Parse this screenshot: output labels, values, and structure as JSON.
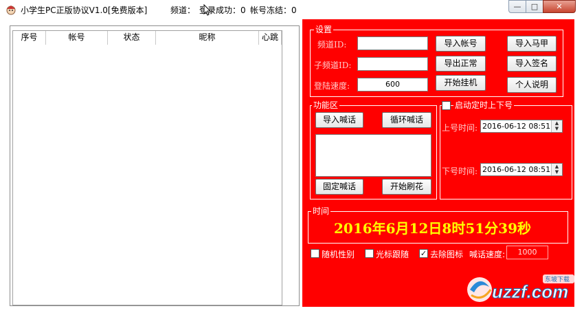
{
  "window": {
    "title": "小学生PC正版协议V1.0[免费版本]",
    "channel_label": "频道：",
    "login_label": "登录成功：0",
    "frozen_label": "帐号冻结：0",
    "btn_min": "—",
    "btn_max": "□",
    "btn_close": "✕"
  },
  "account_table": {
    "columns": [
      "序号",
      "帐号",
      "状态",
      "昵称",
      "心跳"
    ],
    "rows": []
  },
  "settings": {
    "group_title": "设置",
    "channel_id_label": "频道ID:",
    "channel_id_value": "",
    "sub_channel_id_label": "子频道ID:",
    "sub_channel_id_value": "",
    "login_speed_label": "登陆速度:",
    "login_speed_value": "600",
    "import_accounts_button": "导入帐号",
    "export_normal_button": "导出正常",
    "start_hang_button": "开始挂机",
    "import_vest_button": "导入马甲",
    "import_signature_button": "导入签名",
    "personal_info_button": "个人说明"
  },
  "function_area": {
    "group_title": "功能区",
    "import_shout_button": "导入喊话",
    "loop_shout_button": "循环喊话",
    "fixed_shout_button": "固定喊话",
    "start_flower_button": "开始刷花",
    "memo_text": ""
  },
  "schedule": {
    "enable_label": "启动定时上下号",
    "enabled": false,
    "online_time_label": "上号时间:",
    "online_time_value": "2016-06-12  08:51",
    "offline_time_label": "下号时间:",
    "offline_time_value": "2016-06-12  08:51"
  },
  "time_group": {
    "group_title": "时间",
    "clock": "2016年6月12日8时51分39秒"
  },
  "options": {
    "random_gender_label": "随机性别",
    "random_gender_checked": false,
    "cursor_follow_label": "光标跟随",
    "cursor_follow_checked": false,
    "remove_icon_label": "去除图标",
    "remove_icon_checked": true,
    "shout_speed_label": "喊话速度:",
    "shout_speed_value": "1000"
  },
  "watermark": {
    "brand": "uzzf.com",
    "sub": "东坡下载"
  },
  "colors": {
    "panel_red": "#ff0000",
    "clock_yellow": "#ffff00"
  }
}
